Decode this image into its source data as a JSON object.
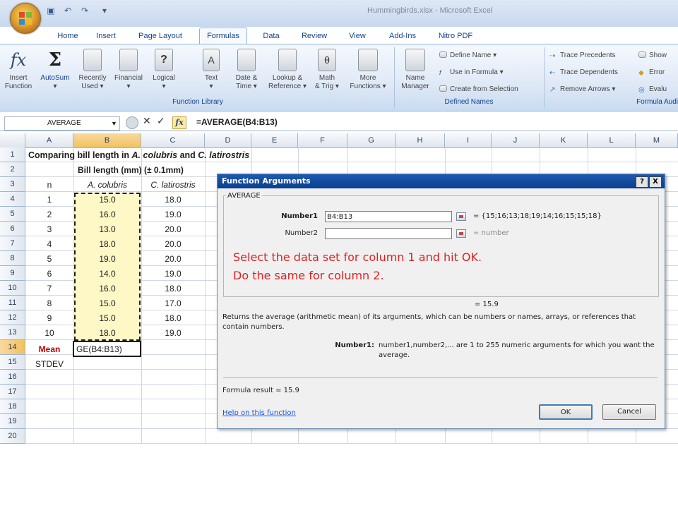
{
  "window": {
    "title": "Hummingbirds.xlsx - Microsoft Excel"
  },
  "tabs": [
    "Home",
    "Insert",
    "Page Layout",
    "Formulas",
    "Data",
    "Review",
    "View",
    "Add-Ins",
    "Nitro PDF"
  ],
  "active_tab": "Formulas",
  "ribbon": {
    "function_library": {
      "buttons": [
        {
          "line1": "Insert",
          "line2": "Function"
        },
        {
          "line1": "AutoSum",
          "line2": "▾"
        },
        {
          "line1": "Recently",
          "line2": "Used ▾"
        },
        {
          "line1": "Financial",
          "line2": "▾"
        },
        {
          "line1": "Logical",
          "line2": "▾"
        },
        {
          "line1": "Text",
          "line2": "▾"
        },
        {
          "line1": "Date &",
          "line2": "Time ▾"
        },
        {
          "line1": "Lookup &",
          "line2": "Reference ▾"
        },
        {
          "line1": "Math",
          "line2": "& Trig ▾"
        },
        {
          "line1": "More",
          "line2": "Functions ▾"
        }
      ],
      "label": "Function Library"
    },
    "defined_names": {
      "name_manager": {
        "line1": "Name",
        "line2": "Manager"
      },
      "items": [
        "Define Name ▾",
        "Use in Formula ▾",
        "Create from Selection"
      ],
      "label": "Defined Names"
    },
    "formula_auditing": {
      "col1": [
        "Trace Precedents",
        "Trace Dependents",
        "Remove Arrows ▾"
      ],
      "col2": [
        "Show",
        "Error",
        "Evalu"
      ],
      "label": "Formula Audi"
    }
  },
  "formula_bar": {
    "name_box": "AVERAGE",
    "fx": "fx",
    "formula": "=AVERAGE(B4:B13)"
  },
  "columns": [
    "A",
    "B",
    "C",
    "D",
    "E",
    "F",
    "G",
    "H",
    "I",
    "J",
    "K",
    "L",
    "M"
  ],
  "rows": [
    "1",
    "2",
    "3",
    "4",
    "5",
    "6",
    "7",
    "8",
    "9",
    "10",
    "11",
    "12",
    "13",
    "14",
    "15",
    "16",
    "17",
    "18",
    "19",
    "20"
  ],
  "sheet": {
    "a1": {
      "plain": "Comparing bill length in ",
      "sp1": "A. colubris",
      "mid": " and ",
      "sp2": "C. latirostris"
    },
    "b2": "Bill length (mm) (± 0.1mm)",
    "headers": {
      "n": "n",
      "b": "A. colubris",
      "c": "C. latirostris"
    },
    "n_values": [
      "1",
      "2",
      "3",
      "4",
      "5",
      "6",
      "7",
      "8",
      "9",
      "10"
    ],
    "b_values": [
      "15.0",
      "16.0",
      "13.0",
      "18.0",
      "19.0",
      "14.0",
      "16.0",
      "15.0",
      "15.0",
      "18.0"
    ],
    "c_values": [
      "18.0",
      "19.0",
      "20.0",
      "20.0",
      "20.0",
      "19.0",
      "18.0",
      "17.0",
      "18.0",
      "19.0"
    ],
    "mean_label": "Mean",
    "mean_edit": "GE(B4:B13)",
    "stdev_label": "STDEV"
  },
  "colors": {
    "mean": "#c00000",
    "instruction": "#e02020",
    "selection": "#fdf8c6",
    "title_bar": "#0a3f8f"
  },
  "dialog": {
    "title": "Function Arguments",
    "help_btn": "?",
    "close_btn": "X",
    "function": "AVERAGE",
    "number1_label": "Number1",
    "number1_value": "B4:B13",
    "number1_result": "= {15;16;13;18;19;14;16;15;15;18}",
    "number2_label": "Number2",
    "number2_value": "",
    "number2_result": "= number",
    "instruction1": "Select the data set for column 1 and hit OK.",
    "instruction2": "Do the same for column 2.",
    "result_line": "= 15.9",
    "description": "Returns the average (arithmetic mean) of its arguments, which can be numbers or names, arrays, or references that contain numbers.",
    "arg_help_label": "Number1:",
    "arg_help_text": "number1,number2,... are 1 to 255 numeric arguments for which you want the average.",
    "formula_result": "Formula result =  15.9",
    "help_link": "Help on this function",
    "ok": "OK",
    "cancel": "Cancel"
  }
}
